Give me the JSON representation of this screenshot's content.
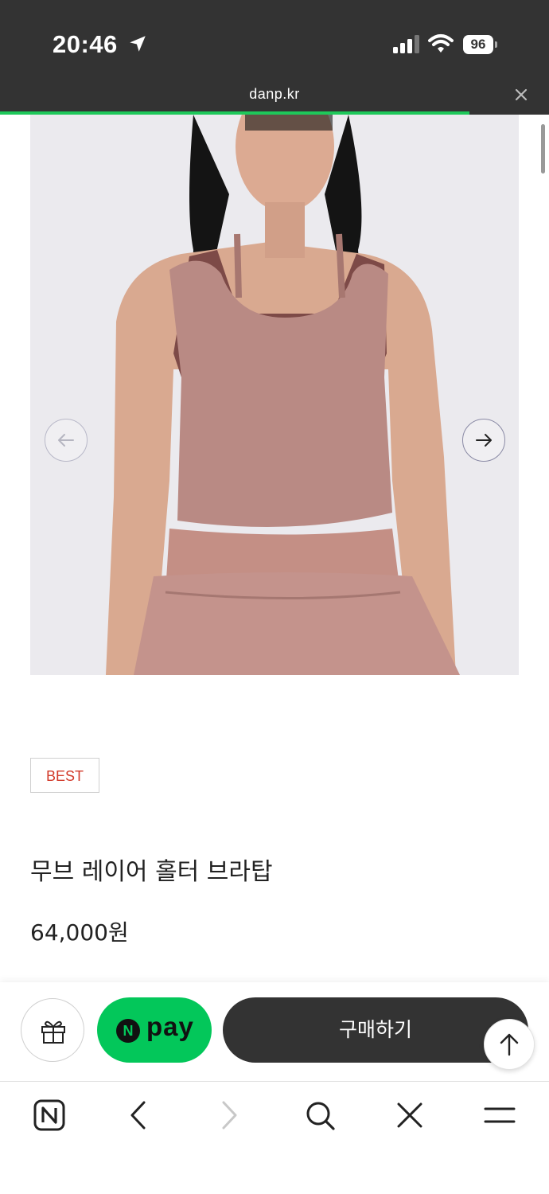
{
  "status_bar": {
    "time": "20:46",
    "battery": "96"
  },
  "browser": {
    "url": "danp.kr",
    "load_progress": 0.855
  },
  "product": {
    "badge": "BEST",
    "title": "무브 레이어 홀터 브라탑",
    "price": "64,000원",
    "image_colors": {
      "top": "#b98a84",
      "trim": "#7d4a47",
      "background": "#ebeaee"
    }
  },
  "actions": {
    "npay_logo": "N",
    "npay_label": "pay",
    "buy_label": "구매하기"
  },
  "icons": [
    "location-icon",
    "signal-icon",
    "wifi-icon",
    "battery-icon",
    "close-icon",
    "arrow-left-icon",
    "arrow-right-icon",
    "gift-icon",
    "arrow-up-icon",
    "naver-icon",
    "chevron-left-icon",
    "chevron-right-icon",
    "search-icon",
    "menu-icon"
  ],
  "colors": {
    "accent_green": "#03c75a",
    "dark": "#333333",
    "badge_red": "#d23a2a"
  }
}
